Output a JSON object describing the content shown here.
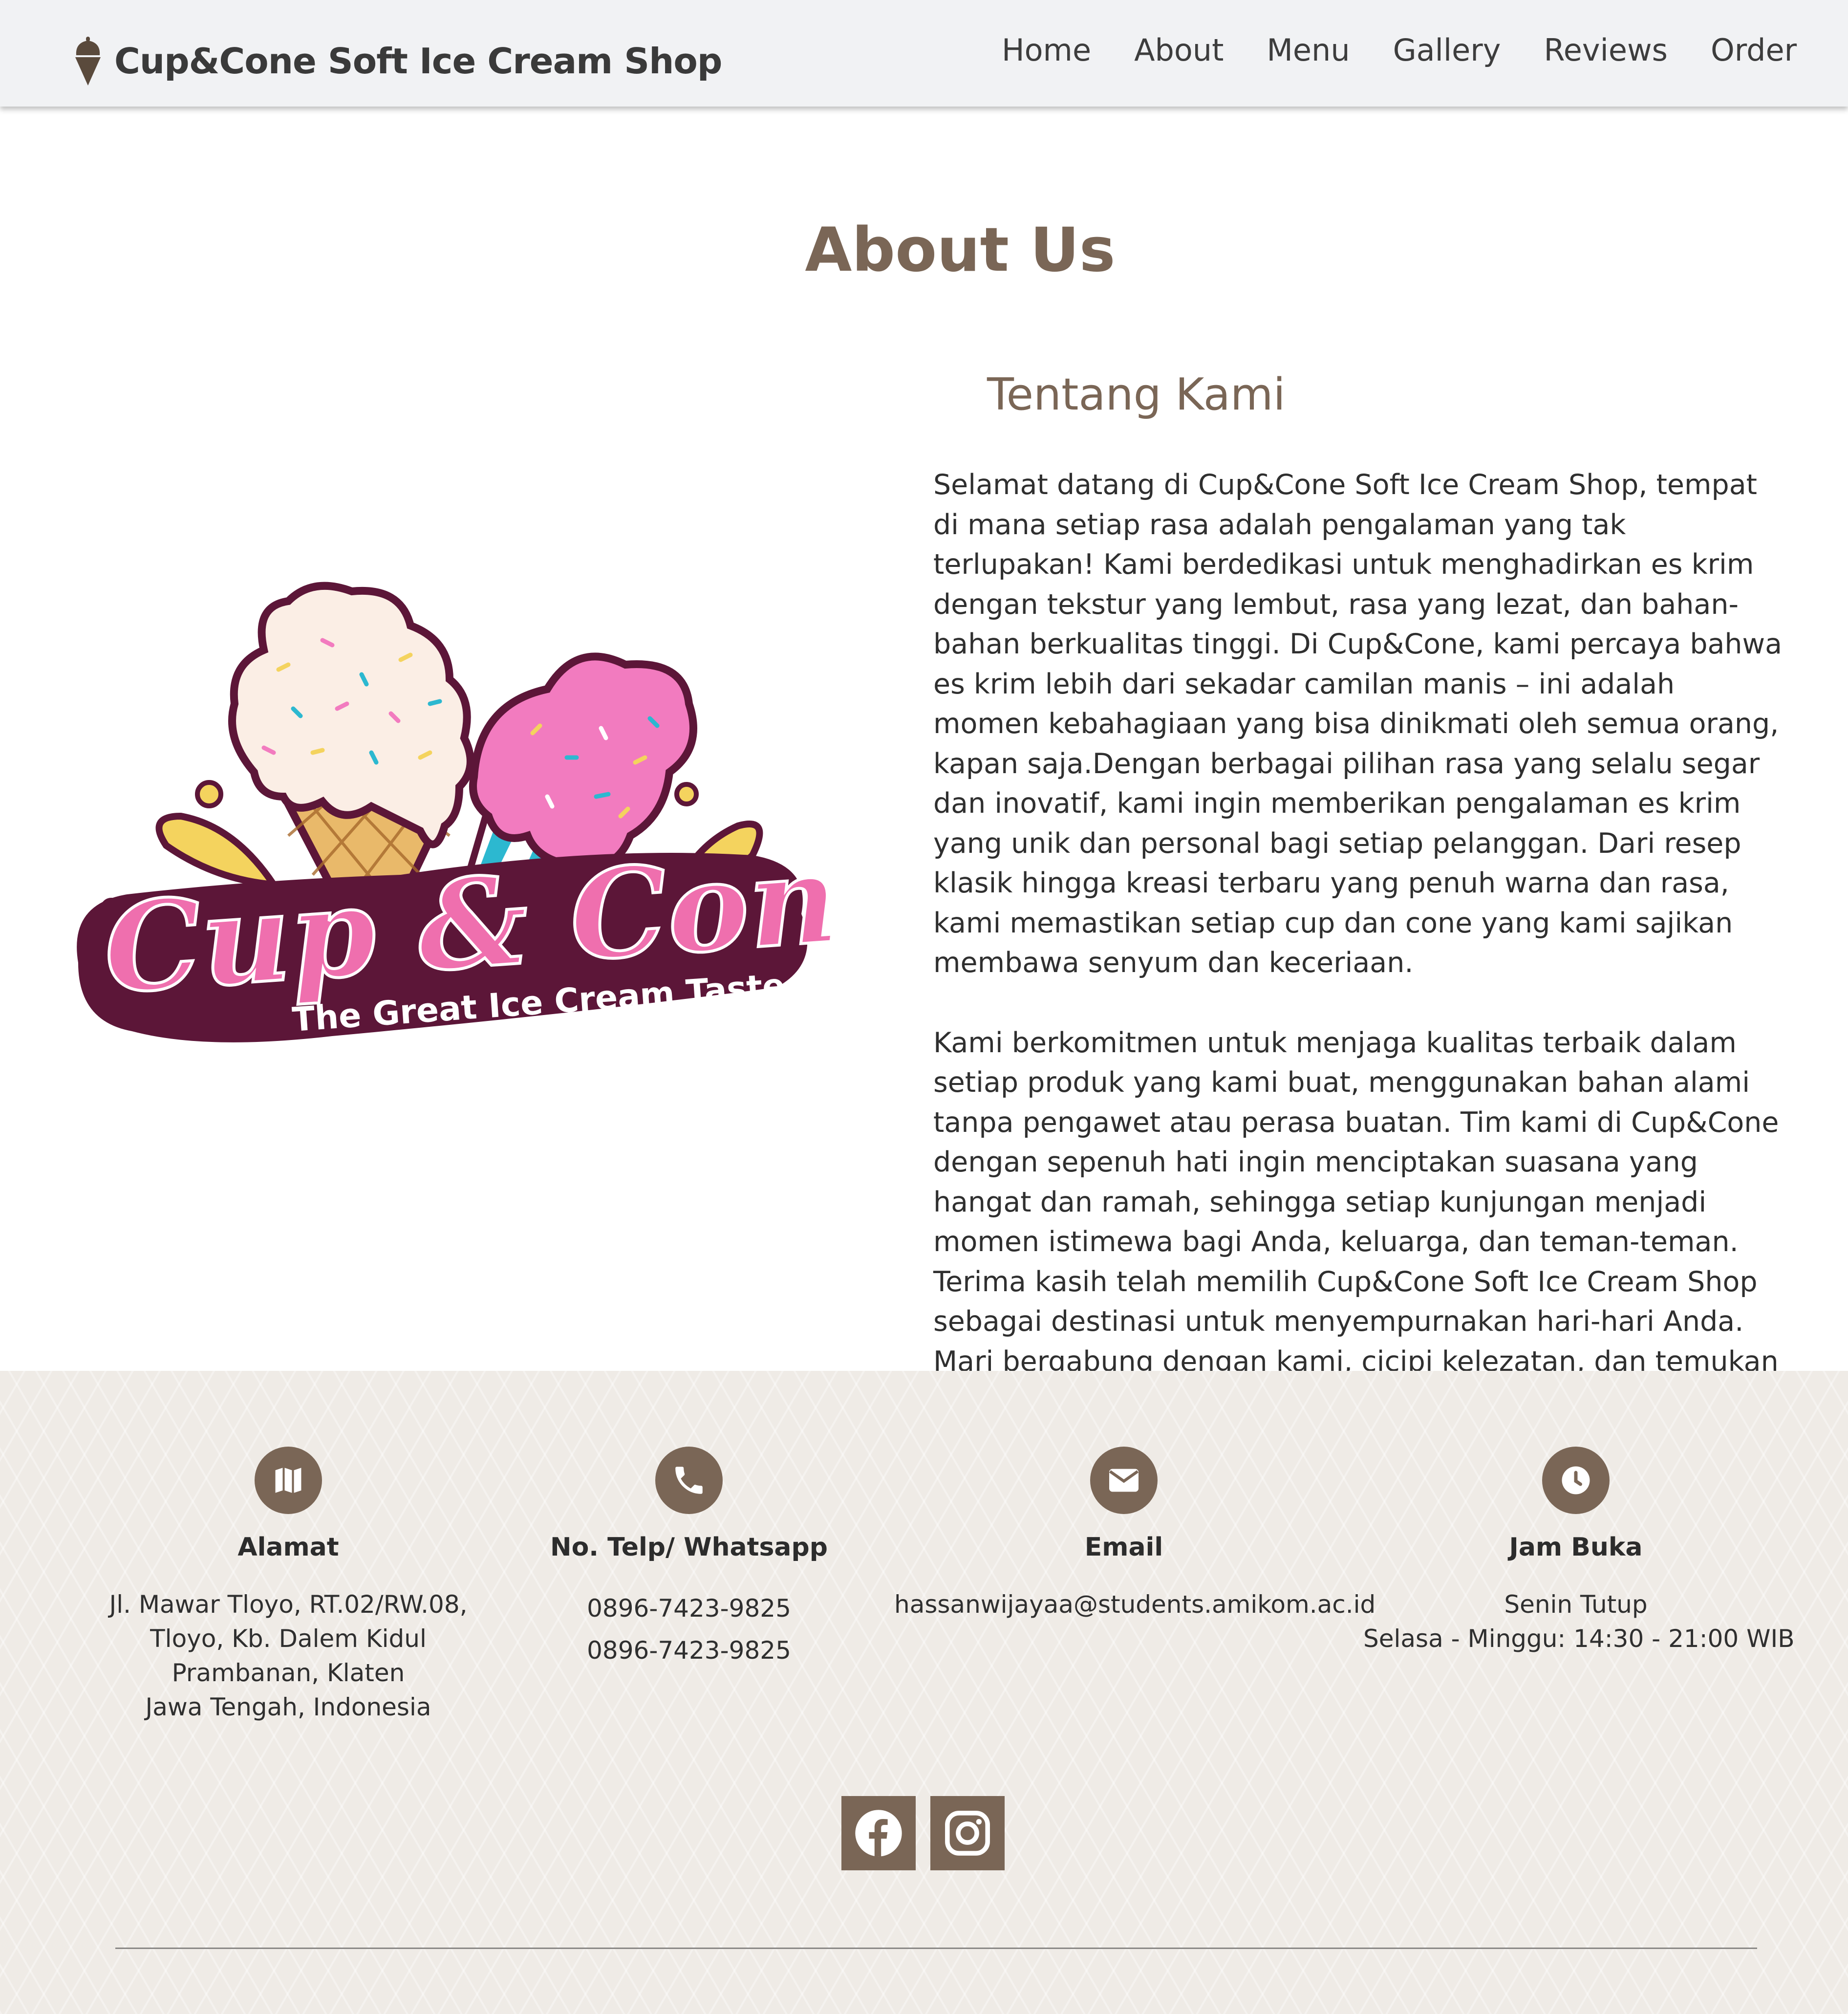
{
  "navbar": {
    "brand": "Cup&Cone Soft Ice Cream Shop",
    "links": [
      "Home",
      "About",
      "Menu",
      "Gallery",
      "Reviews",
      "Order"
    ]
  },
  "about": {
    "title": "About Us",
    "subtitle": "Tentang Kami",
    "logo": {
      "main_text": "Cup & Cone",
      "tagline": "The Great Ice Cream Taste"
    },
    "paragraphs": [
      "Selamat datang di Cup&Cone Soft Ice Cream Shop, tempat di mana setiap rasa adalah pengalaman yang tak terlupakan! Kami berdedikasi untuk menghadirkan es krim dengan tekstur yang lembut, rasa yang lezat, dan bahan-bahan berkualitas tinggi. Di Cup&Cone, kami percaya bahwa es krim lebih dari sekadar camilan manis – ini adalah momen kebahagiaan yang bisa dinikmati oleh semua orang, kapan saja.Dengan berbagai pilihan rasa yang selalu segar dan inovatif, kami ingin memberikan pengalaman es krim yang unik dan personal bagi setiap pelanggan. Dari resep klasik hingga kreasi terbaru yang penuh warna dan rasa, kami memastikan setiap cup dan cone yang kami sajikan membawa senyum dan keceriaan.",
      "Kami berkomitmen untuk menjaga kualitas terbaik dalam setiap produk yang kami buat, menggunakan bahan alami tanpa pengawet atau perasa buatan. Tim kami di Cup&Cone dengan sepenuh hati ingin menciptakan suasana yang hangat dan ramah, sehingga setiap kunjungan menjadi momen istimewa bagi Anda, keluarga, dan teman-teman. Terima kasih telah memilih Cup&Cone Soft Ice Cream Shop sebagai destinasi untuk menyempurnakan hari-hari Anda. Mari bergabung dengan kami, cicipi kelezatan, dan temukan es krim favorit Anda di tempat di mana rasa dan kualitas adalah prioritas utama!"
    ]
  },
  "footer": {
    "address": {
      "icon": "map-icon",
      "label": "Alamat",
      "lines": [
        "Jl. Mawar Tloyo, RT.02/RW.08,",
        "Tloyo, Kb. Dalem Kidul",
        "Prambanan, Klaten",
        "Jawa Tengah, Indonesia"
      ]
    },
    "phone": {
      "icon": "phone-icon",
      "label": "No. Telp/ Whatsapp",
      "lines": [
        "0896-7423-9825",
        "0896-7423-9825"
      ]
    },
    "email": {
      "icon": "mail-icon",
      "label": "Email",
      "lines": [
        "hassanwijayaa@students.amikom.ac.id"
      ]
    },
    "hours": {
      "icon": "clock-icon",
      "label": "Jam Buka",
      "lines": [
        "Senin Tutup",
        "Selasa - Minggu: 14:30 - 21:00 WIB"
      ]
    },
    "social": [
      "facebook-icon",
      "instagram-icon"
    ]
  },
  "colors": {
    "accent": "#7a6656",
    "navbar_bg": "#f1f2f4",
    "footer_bg": "#efebe6",
    "logo_pink": "#ef6fae",
    "logo_maroon": "#5c1638"
  }
}
